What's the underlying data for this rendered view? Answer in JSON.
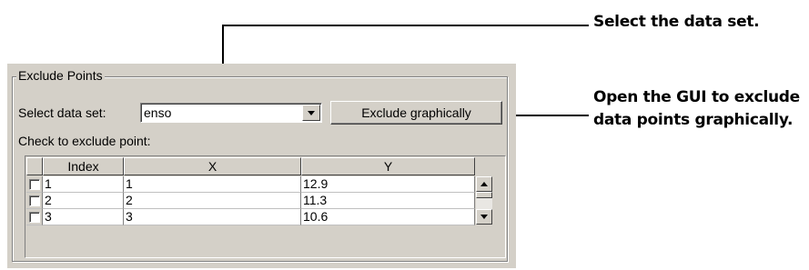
{
  "group": {
    "title": "Exclude Points"
  },
  "dataset": {
    "label": "Select data set:",
    "value": "enso"
  },
  "exclude_button": {
    "label": "Exclude graphically"
  },
  "table_caption": "Check to exclude point:",
  "table": {
    "headers": [
      "Index",
      "X",
      "Y"
    ],
    "rows": [
      {
        "index": "1",
        "x": "1",
        "y": "12.9"
      },
      {
        "index": "2",
        "x": "2",
        "y": "11.3"
      },
      {
        "index": "3",
        "x": "3",
        "y": "10.6"
      }
    ]
  },
  "callouts": {
    "select": "Select the data set.",
    "open_line1": "Open the GUI to exclude",
    "open_line2": "data points graphically."
  },
  "colors": {
    "panel_bg": "#d4d0c8",
    "field_bg": "#ffffff"
  },
  "icons": {
    "combo_arrow": "chevron-down-icon",
    "scroll_up": "arrow-up-icon",
    "scroll_down": "arrow-down-icon"
  }
}
